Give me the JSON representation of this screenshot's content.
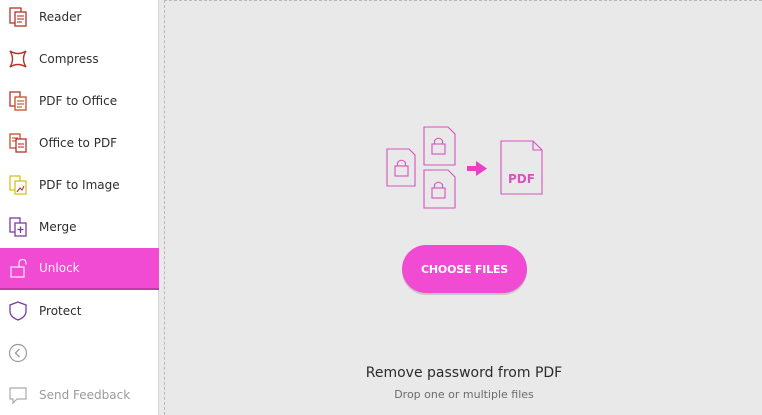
{
  "sidebar": {
    "items": [
      {
        "label": "Reader",
        "icon": "reader-icon"
      },
      {
        "label": "Compress",
        "icon": "compress-icon"
      },
      {
        "label": "PDF to Office",
        "icon": "pdf-to-office-icon"
      },
      {
        "label": "Office to PDF",
        "icon": "office-to-pdf-icon"
      },
      {
        "label": "PDF to Image",
        "icon": "pdf-to-image-icon"
      },
      {
        "label": "Merge",
        "icon": "merge-icon"
      },
      {
        "label": "Unlock",
        "icon": "unlock-icon",
        "active": true
      },
      {
        "label": "Protect",
        "icon": "shield-icon"
      }
    ],
    "back_icon": "back-arrow-icon",
    "feedback_label": "Send Feedback",
    "feedback_icon": "feedback-icon"
  },
  "main": {
    "illustration": {
      "target_label": "PDF"
    },
    "choose_button": "CHOOSE FILES",
    "title": "Remove password from PDF",
    "subtitle": "Drop one or multiple files"
  },
  "colors": {
    "accent": "#f14ad3",
    "icon_orange": "#c0502a",
    "icon_red": "#b7332a",
    "icon_yellow": "#d8c21a",
    "icon_purple": "#7b3aa8"
  }
}
